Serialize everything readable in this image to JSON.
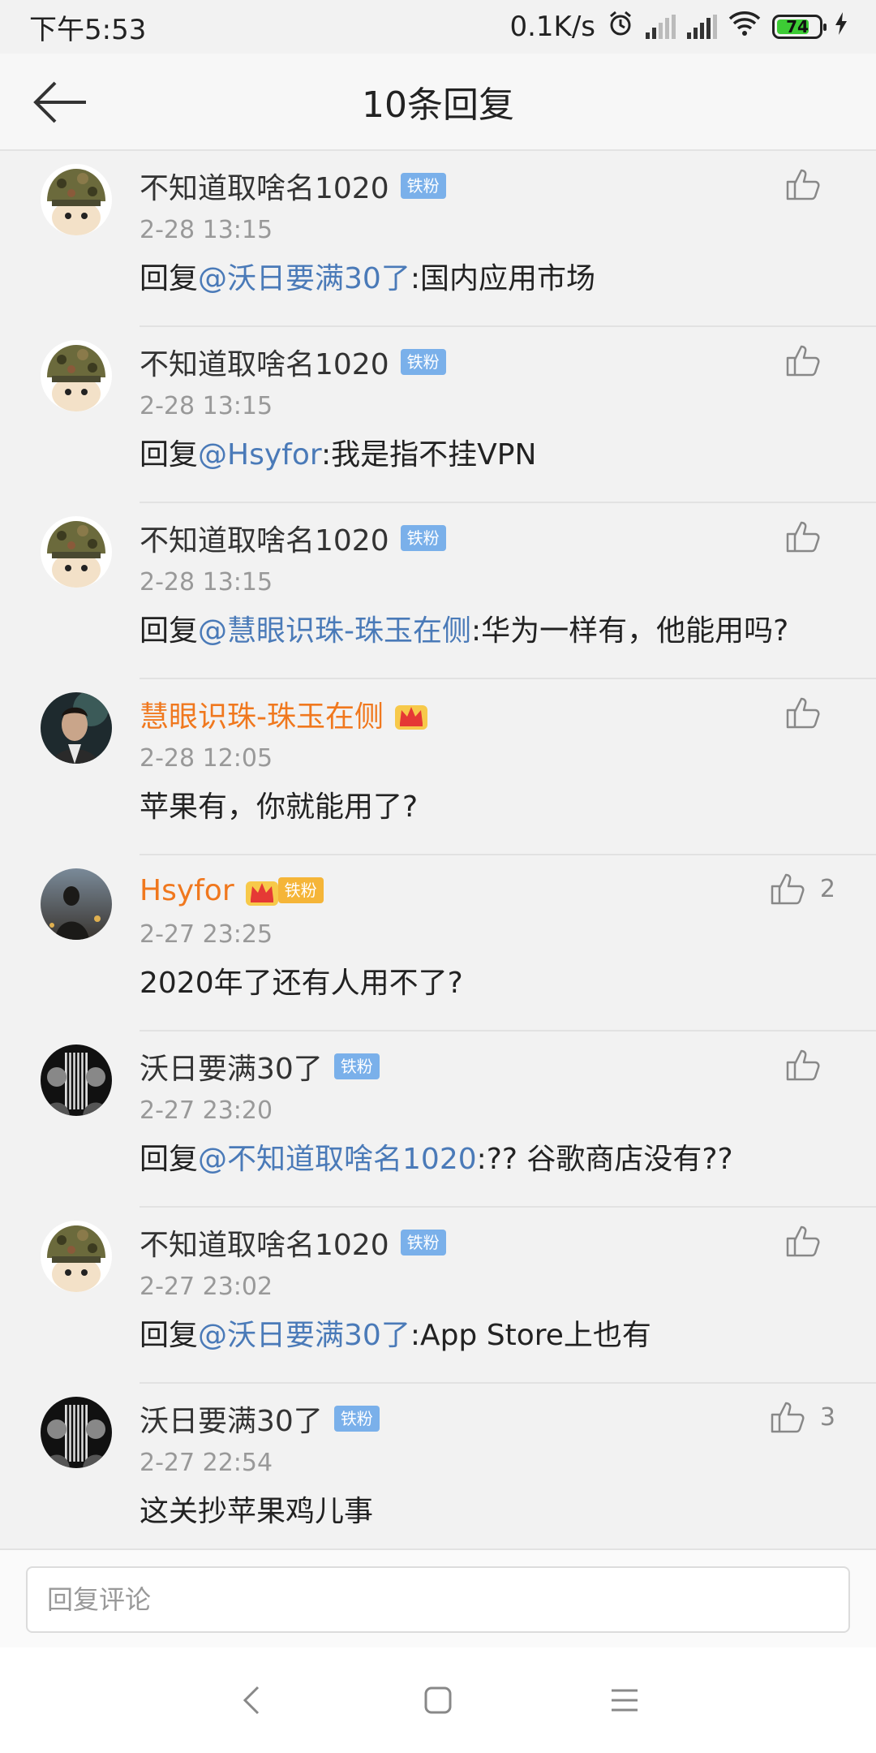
{
  "status_bar": {
    "time": "下午5:53",
    "network_speed": "0.1K/s",
    "battery_level": "74",
    "icons": [
      "alarm-icon",
      "signal-icon",
      "signal-icon",
      "wifi-icon",
      "battery-icon",
      "charging-icon"
    ]
  },
  "header": {
    "title": "10条回复",
    "back_icon": "back-arrow-icon"
  },
  "badges": {
    "fan": "铁粉"
  },
  "comments": [
    {
      "user": "不知道取啥名1020",
      "time": "2-28 13:15",
      "reply_prefix": "回复",
      "mention": "@沃日要满30了",
      "text": ":国内应用市场",
      "likes": ""
    },
    {
      "user": "不知道取啥名1020",
      "time": "2-28 13:15",
      "reply_prefix": "回复",
      "mention": "@Hsyfor",
      "text": ":我是指不挂VPN",
      "likes": ""
    },
    {
      "user": "不知道取啥名1020",
      "time": "2-28 13:15",
      "reply_prefix": "回复",
      "mention": "@慧眼识珠-珠玉在侧",
      "text": ":华为一样有，他能用吗?",
      "likes": ""
    },
    {
      "user": "慧眼识珠-珠玉在侧",
      "time": "2-28 12:05",
      "reply_prefix": "",
      "mention": "",
      "text": "苹果有，你就能用了?",
      "likes": ""
    },
    {
      "user": "Hsyfor",
      "time": "2-27 23:25",
      "reply_prefix": "",
      "mention": "",
      "text": "2020年了还有人用不了?",
      "likes": "2"
    },
    {
      "user": "沃日要满30了",
      "time": "2-27 23:20",
      "reply_prefix": "回复",
      "mention": "@不知道取啥名1020",
      "text": ":?? 谷歌商店没有??",
      "likes": ""
    },
    {
      "user": "不知道取啥名1020",
      "time": "2-27 23:02",
      "reply_prefix": "回复",
      "mention": "@沃日要满30了",
      "text": ":App Store上也有",
      "likes": ""
    },
    {
      "user": "沃日要满30了",
      "time": "2-27 22:54",
      "reply_prefix": "",
      "mention": "",
      "text": "这关抄苹果鸡儿事",
      "likes": "3"
    }
  ],
  "reply": {
    "placeholder": "回复评论"
  },
  "nav_bar": {
    "icons": [
      "nav-back-icon",
      "nav-home-icon",
      "nav-menu-icon"
    ]
  }
}
